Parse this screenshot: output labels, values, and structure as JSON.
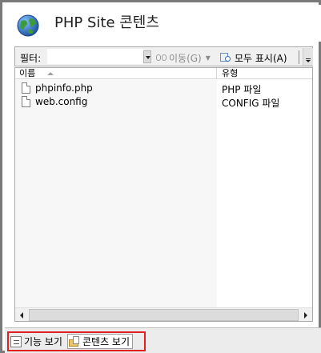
{
  "header": {
    "title": "PHP Site 콘텐츠",
    "icon": "globe-icon"
  },
  "toolbar": {
    "filter_label": "필터:",
    "filter_value": "",
    "go_label": "이동(G)",
    "show_all_label": "모두 표시(A)"
  },
  "list": {
    "columns": [
      "이름",
      "유형"
    ],
    "sort_column": "이름",
    "rows": [
      {
        "name": "phpinfo.php",
        "type": "PHP 파일"
      },
      {
        "name": "web.config",
        "type": "CONFIG 파일"
      }
    ]
  },
  "viewbar": {
    "features_view_label": "기능 보기",
    "content_view_label": "콘텐츠 보기",
    "active_view": "콘텐츠 보기",
    "highlight_color": "#e02020"
  }
}
